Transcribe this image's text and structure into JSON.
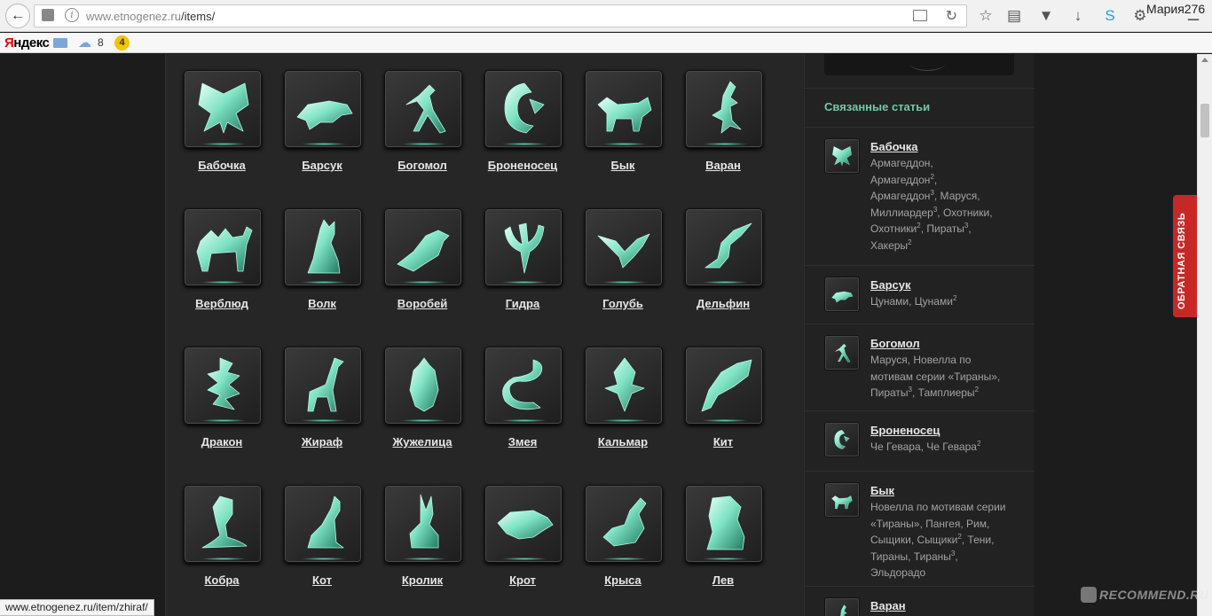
{
  "browser": {
    "url_host": "www.etnogenez.ru",
    "url_path": "/items/",
    "user_name": "Мария276",
    "status_url": "www.etnogenez.ru/item/zhiraf/"
  },
  "bookmarks": {
    "yandex_first": "Я",
    "yandex_rest": "ндекс",
    "weather_temp": "8",
    "traffic_level": "4"
  },
  "items": [
    {
      "label": "Бабочка",
      "icon": "butterfly"
    },
    {
      "label": "Барсук",
      "icon": "badger"
    },
    {
      "label": "Богомол",
      "icon": "mantis"
    },
    {
      "label": "Броненосец",
      "icon": "armadillo"
    },
    {
      "label": "Бык",
      "icon": "bull"
    },
    {
      "label": "Варан",
      "icon": "monitor-lizard"
    },
    {
      "label": "Верблюд",
      "icon": "camel"
    },
    {
      "label": "Волк",
      "icon": "wolf"
    },
    {
      "label": "Воробей",
      "icon": "sparrow"
    },
    {
      "label": "Гидра",
      "icon": "hydra"
    },
    {
      "label": "Голубь",
      "icon": "dove"
    },
    {
      "label": "Дельфин",
      "icon": "dolphin"
    },
    {
      "label": "Дракон",
      "icon": "dragon"
    },
    {
      "label": "Жираф",
      "icon": "giraffe"
    },
    {
      "label": "Жужелица",
      "icon": "beetle"
    },
    {
      "label": "Змея",
      "icon": "snake"
    },
    {
      "label": "Кальмар",
      "icon": "squid"
    },
    {
      "label": "Кит",
      "icon": "whale"
    },
    {
      "label": "Кобра",
      "icon": "cobra"
    },
    {
      "label": "Кот",
      "icon": "cat"
    },
    {
      "label": "Кролик",
      "icon": "rabbit"
    },
    {
      "label": "Крот",
      "icon": "mole"
    },
    {
      "label": "Крыса",
      "icon": "rat"
    },
    {
      "label": "Лев",
      "icon": "lion"
    }
  ],
  "sidebar": {
    "title": "Связанные статьи",
    "articles": [
      {
        "title": "Бабочка",
        "icon": "butterfly",
        "tags_html": "Армагеддон,<br>Армагеддон<sup>2</sup>,<br>Армагеддон<sup>3</sup>, Маруся,<br>Миллиардер<sup>3</sup>, Охотники,<br>Охотники<sup>2</sup>, Пираты<sup>3</sup>,<br>Хакеры<sup>2</sup>"
      },
      {
        "title": "Барсук",
        "icon": "badger",
        "tags_html": "Цунами, Цунами<sup>2</sup>"
      },
      {
        "title": "Богомол",
        "icon": "mantis",
        "tags_html": "Маруся, Новелла по<br>мотивам серии «Тираны»,<br>Пираты<sup>3</sup>, Тамплиеры<sup>2</sup>"
      },
      {
        "title": "Броненосец",
        "icon": "armadillo",
        "tags_html": "Че Гевара, Че Гевара<sup>2</sup>"
      },
      {
        "title": "Бык",
        "icon": "bull",
        "tags_html": "Новелла по мотивам серии<br>«Тираны», Пангея, Рим,<br>Сыщики, Сыщики<sup>2</sup>, Тени,<br>Тираны, Тираны<sup>3</sup>,<br>Эльдорадо"
      },
      {
        "title": "Варан",
        "icon": "monitor-lizard",
        "tags_html": ""
      }
    ]
  },
  "feedback_label": "ОБРАТНАЯ СВЯЗЬ",
  "watermark": "RECOMMEND.RU"
}
